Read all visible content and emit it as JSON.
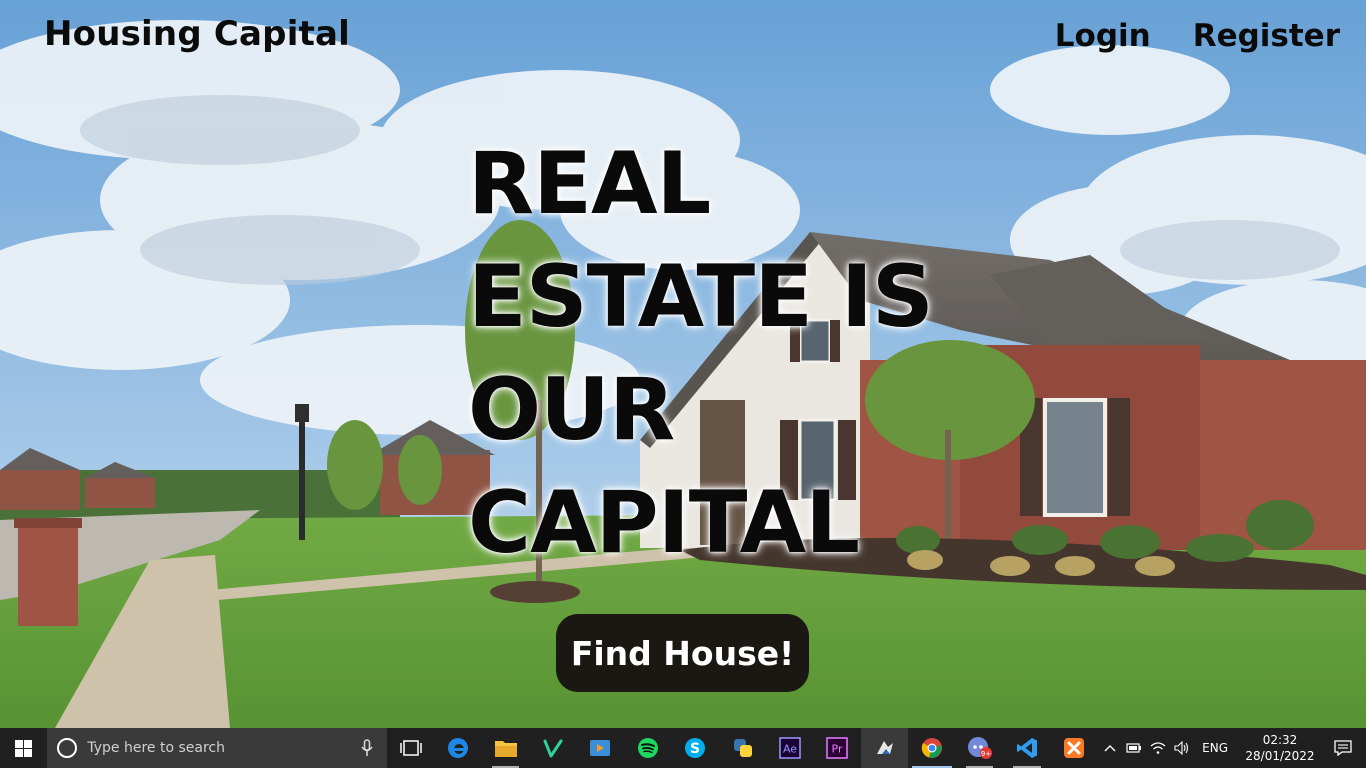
{
  "site": {
    "brand": "Housing Capital",
    "nav": {
      "login": "Login",
      "register": "Register"
    },
    "headline": [
      "REAL",
      "ESTATE IS",
      "OUR",
      "CAPITAL"
    ],
    "cta_label": "Find House!"
  },
  "taskbar": {
    "search_placeholder": "Type here to search",
    "apps": [
      "task-view",
      "edge",
      "file-explorer",
      "vine",
      "media-player",
      "spotify",
      "skype",
      "python",
      "after-effects",
      "premiere-pro",
      "jupyter",
      "chrome",
      "discord",
      "vscode",
      "xampp"
    ],
    "app_labels": {
      "after_effects": "Ae",
      "premiere": "Pr"
    },
    "discord_badge": "9+",
    "language": "ENG",
    "time": "02:32",
    "date": "28/01/2022"
  }
}
